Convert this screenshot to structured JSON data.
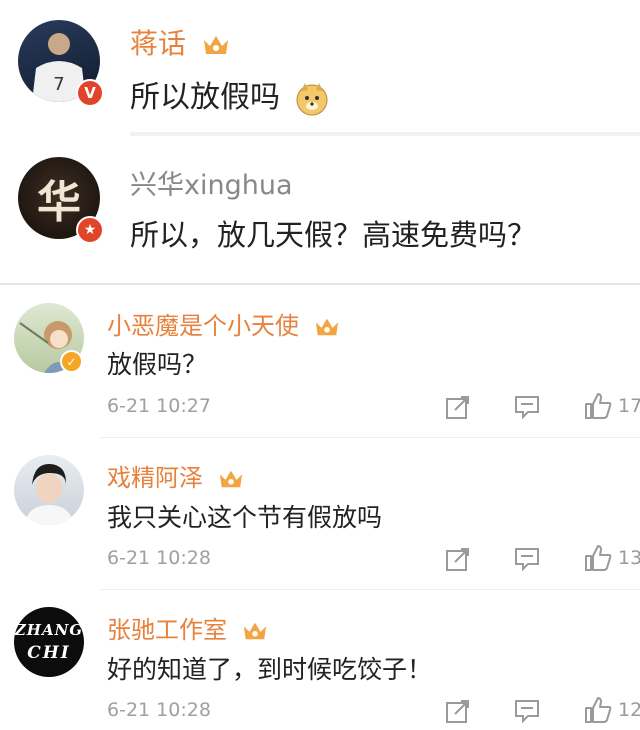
{
  "comments_top": [
    {
      "username": "蒋话",
      "text": "所以放假吗"
    },
    {
      "username": "兴华xinghua",
      "text": "所以，放几天假？高速免费吗？"
    }
  ],
  "comments": [
    {
      "username": "小恶魔是个小天使",
      "text": "放假吗？",
      "time": "6-21 10:27",
      "likes": "17"
    },
    {
      "username": "戏精阿泽",
      "text": "我只关心这个节有假放吗",
      "time": "6-21 10:28",
      "likes": "13"
    },
    {
      "username": "张驰工作室",
      "text": "好的知道了，到时候吃饺子！",
      "time": "6-21 10:28",
      "likes": "12"
    }
  ],
  "avatars": {
    "zhangchi_logo_line1": "ZHANG",
    "zhangchi_logo_line2": "CHI",
    "xinghua_char": "华"
  },
  "colors": {
    "username_orange": "#e8813c",
    "verified_orange": "#f5a623",
    "verified_red": "#e0452a"
  }
}
